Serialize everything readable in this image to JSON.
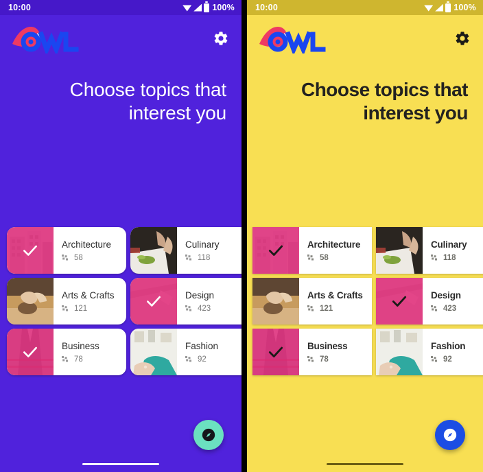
{
  "status_bar": {
    "time": "10:00",
    "battery_percent": "100%",
    "icons": [
      "wifi-icon",
      "cellular-signal-icon",
      "battery-icon"
    ]
  },
  "app": {
    "brand_name": "OWL",
    "settings_icon": "gear-icon",
    "fab_icon": "compass-explore-icon"
  },
  "headline": {
    "line1": "Choose topics that",
    "line2": "interest you"
  },
  "topics": [
    {
      "title": "Architecture",
      "count": "58",
      "selected": true,
      "art": "architecture"
    },
    {
      "title": "Culinary",
      "count": "118",
      "selected": false,
      "art": "culinary"
    },
    {
      "title": "Arts & Crafts",
      "count": "121",
      "selected": false,
      "art": "pottery"
    },
    {
      "title": "Design",
      "count": "423",
      "selected": true,
      "art": "design"
    },
    {
      "title": "Business",
      "count": "78",
      "selected": true,
      "art": "business"
    },
    {
      "title": "Fashion",
      "count": "92",
      "selected": false,
      "art": "fashion"
    }
  ],
  "meta_icon": "course-count-grid-icon",
  "themes": {
    "left": {
      "name": "purple-theme",
      "background": "#5022DC",
      "status_bar": "#4618C9",
      "headline_color": "#FFFFFF",
      "fab_color": "#6BE0C0",
      "fab_icon_color": "#1A1A17",
      "brand_text_color": "#1A46F0",
      "brand_wing_color": "#EE3A63",
      "card_corner": "rounded",
      "home_indicator": "#FFFFFF"
    },
    "right": {
      "name": "yellow-theme",
      "background": "#F8DF53",
      "status_bar": "#CFB62F",
      "headline_color": "#232220",
      "fab_color": "#1B4DE4",
      "fab_icon_color": "#FFFFFF",
      "brand_text_color": "#1A46F0",
      "brand_wing_color": "#EE3A63",
      "card_corner": "square",
      "home_indicator": "#6B5E13"
    }
  },
  "selection_overlay_color": "#E6287B"
}
